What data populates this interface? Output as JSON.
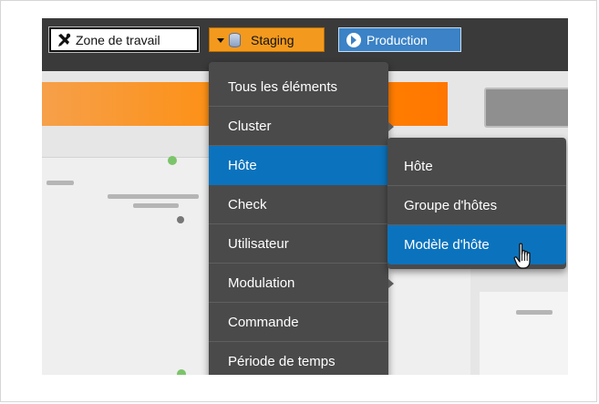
{
  "toolbar": {
    "workspace_label": "Zone de travail",
    "staging_label": "Staging",
    "production_label": "Production"
  },
  "menu": {
    "items": [
      {
        "label": "Tous les éléments"
      },
      {
        "label": "Cluster"
      },
      {
        "label": "Hôte"
      },
      {
        "label": "Check"
      },
      {
        "label": "Utilisateur"
      },
      {
        "label": "Modulation"
      },
      {
        "label": "Commande"
      },
      {
        "label": "Période de temps"
      }
    ],
    "active_index": 2
  },
  "submenu": {
    "items": [
      {
        "label": "Hôte"
      },
      {
        "label": "Groupe d'hôtes"
      },
      {
        "label": "Modèle d'hôte"
      }
    ],
    "active_index": 2
  },
  "colors": {
    "staging": "#f39a1e",
    "production": "#3b82c6",
    "menu_bg": "#4a4a4a",
    "menu_active": "#0b73bd",
    "topbar": "#3a3a3a"
  },
  "icons": {
    "workspace": "tools-icon",
    "staging": "database-icon",
    "production": "play-circle-icon"
  }
}
